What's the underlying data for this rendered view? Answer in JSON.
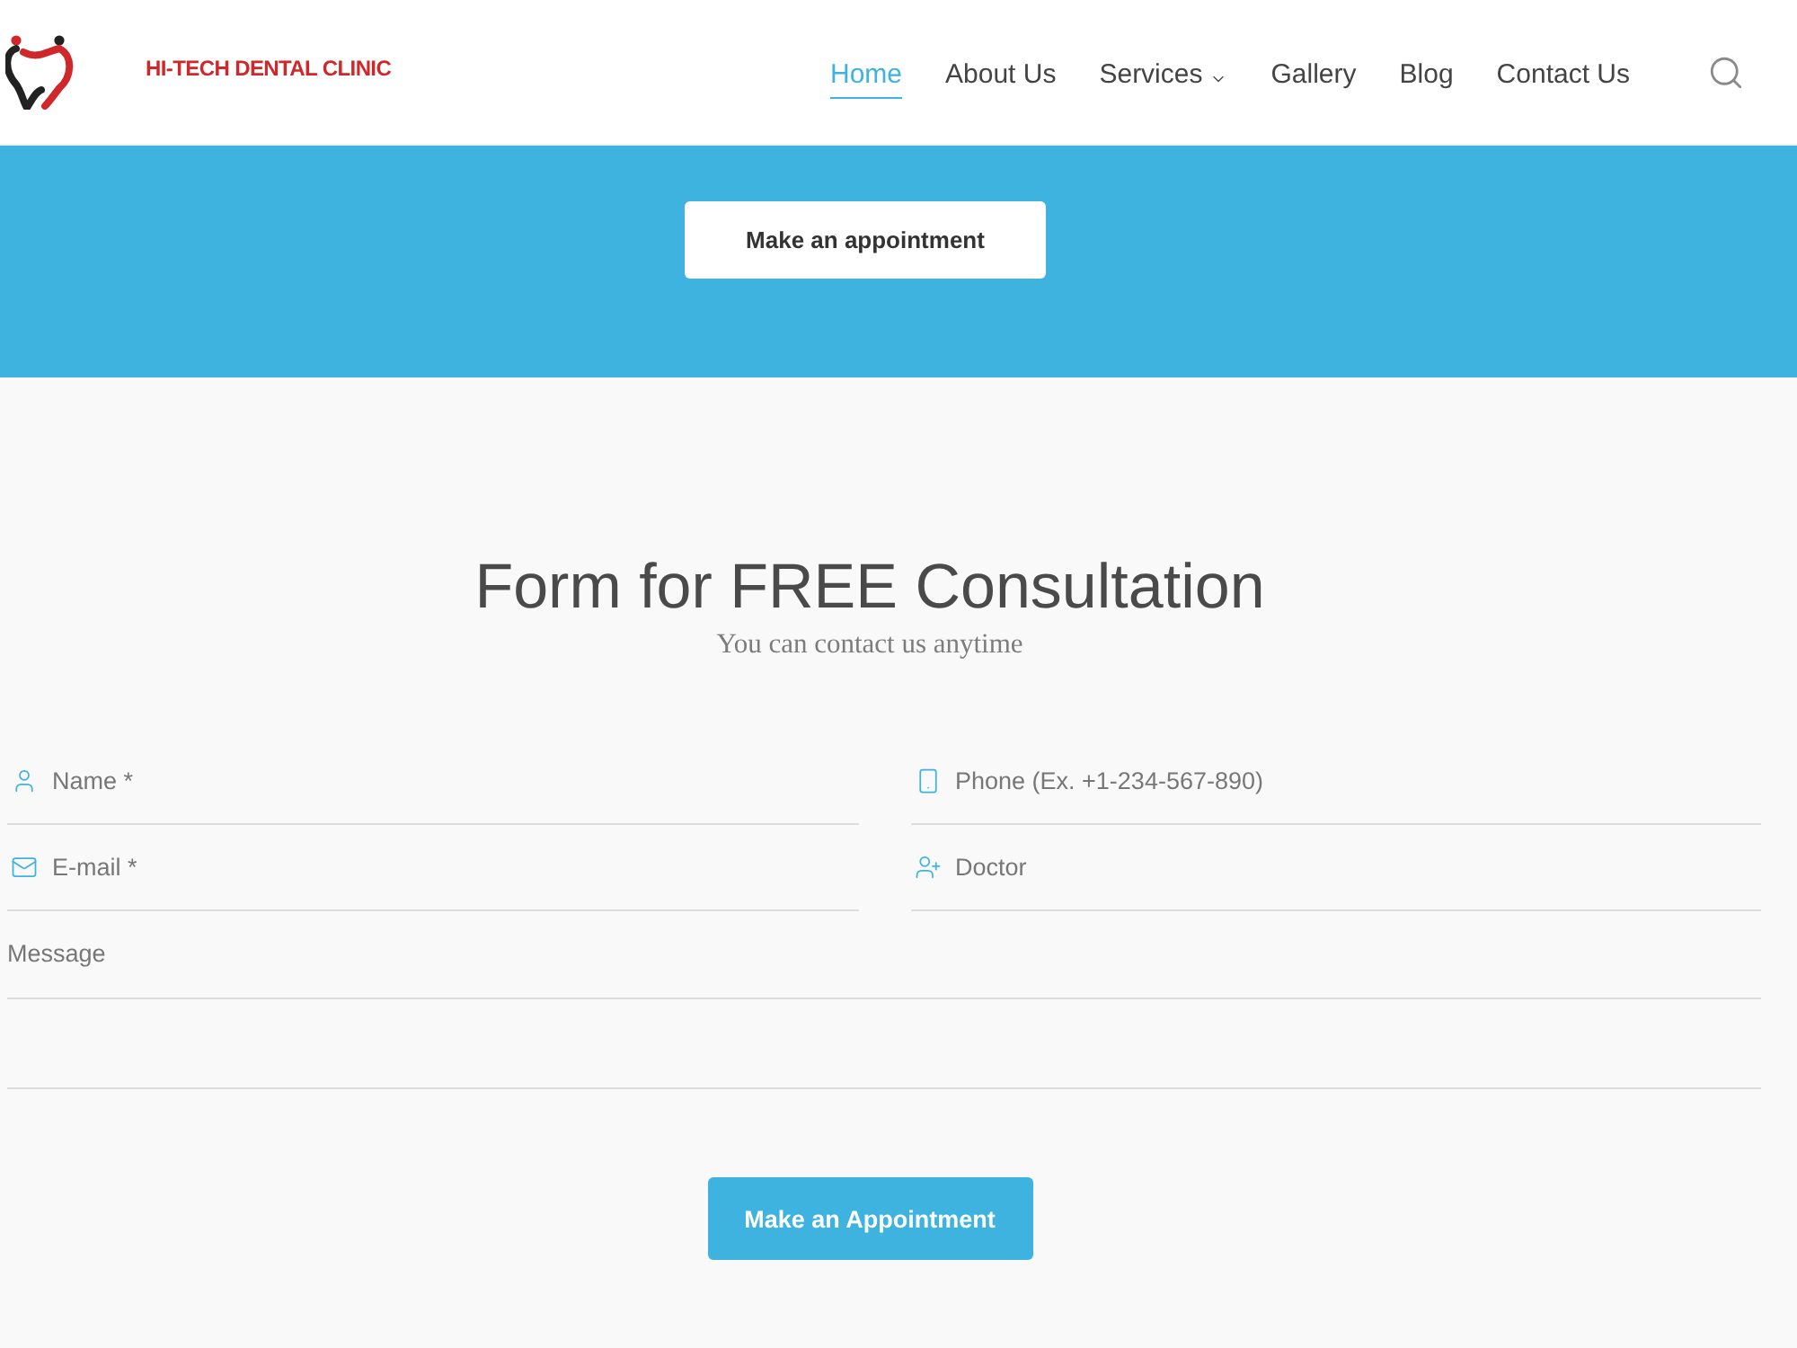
{
  "header": {
    "logo_text": "HI-TECH DENTAL CLINIC",
    "nav": [
      {
        "label": "Home",
        "selected": true,
        "has_dropdown": false
      },
      {
        "label": "About Us",
        "selected": false,
        "has_dropdown": false
      },
      {
        "label": "Services",
        "selected": false,
        "has_dropdown": true
      },
      {
        "label": "Gallery",
        "selected": false,
        "has_dropdown": false
      },
      {
        "label": "Blog",
        "selected": false,
        "has_dropdown": false
      },
      {
        "label": "Contact Us",
        "selected": false,
        "has_dropdown": false
      }
    ]
  },
  "banner": {
    "button": "Make an appointment"
  },
  "form": {
    "title": "Form for FREE Consultation",
    "subtitle": "You can contact us anytime",
    "fields": [
      {
        "kind": "name",
        "placeholder": "Name *"
      },
      {
        "kind": "phone",
        "placeholder": "Phone (Ex. +1-234-567-890)"
      },
      {
        "kind": "email",
        "placeholder": "E-mail *"
      },
      {
        "kind": "doctor",
        "placeholder": "Doctor"
      }
    ],
    "message": {
      "placeholder": "Message"
    },
    "submit": "Make an Appointment"
  }
}
